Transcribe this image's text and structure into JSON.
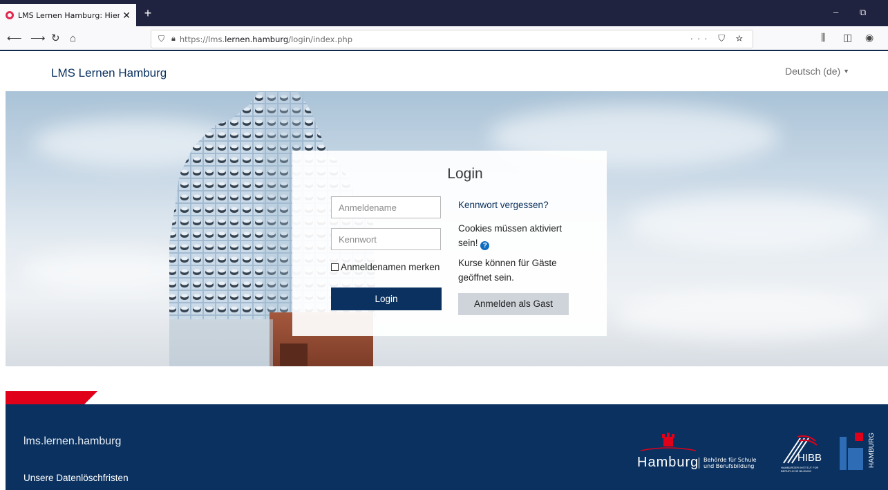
{
  "browser": {
    "tab_title": "LMS Lernen Hamburg: Hier kon",
    "tab_close": "✕",
    "new_tab": "+",
    "url_prefix": "https://lms.",
    "url_domain": "lernen.hamburg",
    "url_path": "/login/index.php",
    "url_actions": "··· ⛉ ☆",
    "minimize": "–",
    "restore": "⧉"
  },
  "header": {
    "brand": "LMS Lernen Hamburg",
    "language": "Deutsch (de)"
  },
  "login": {
    "title": "Login",
    "username_placeholder": "Anmeldename",
    "password_placeholder": "Kennwort",
    "remember_label": "Anmeldenamen merken",
    "login_button": "Login",
    "forgot_link": "Kennwort vergessen?",
    "cookies_text": "Cookies müssen aktiviert sein!",
    "guest_text": "Kurse können für Gäste geöffnet sein.",
    "guest_button": "Anmelden als Gast"
  },
  "footer": {
    "site": "lms.lernen.hamburg",
    "link_deletion": "Unsere Datenlöschfristen",
    "logo_hamburg": "Hamburg",
    "logo_hamburg_sub_1": "Behörde für Schule",
    "logo_hamburg_sub_2": "und Berufsbildung",
    "logo_hibb": "HIBB",
    "logo_hibb_sub": "HAMBURGER INSTITUT FÜR BERUFLICHE BILDUNG",
    "logo_li_vertical": "HAMBURG"
  },
  "colors": {
    "primary": "#0a3160",
    "accent_red": "#e10019",
    "guest_button": "#ced4da"
  }
}
